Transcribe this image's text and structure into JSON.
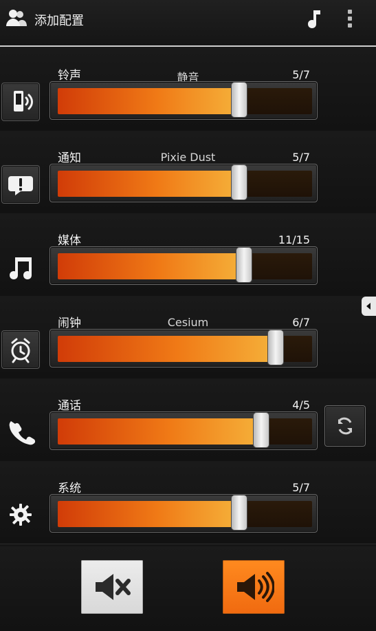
{
  "topbar": {
    "title": "添加配置",
    "icons": [
      "user-group-icon",
      "music-note-icon",
      "overflow-menu-icon"
    ]
  },
  "sliders": [
    {
      "label": "铃声",
      "tone": "静音",
      "value_text": "5/7",
      "value": 5,
      "max": 7,
      "icon": "ringer-phone-icon",
      "icon_has_button": true
    },
    {
      "label": "通知",
      "tone": "Pixie Dust",
      "value_text": "5/7",
      "value": 5,
      "max": 7,
      "icon": "notification-icon",
      "icon_has_button": true
    },
    {
      "label": "媒体",
      "tone": "",
      "value_text": "11/15",
      "value": 11,
      "max": 15,
      "icon": "music-note-icon",
      "icon_has_button": false
    },
    {
      "label": "闹钟",
      "tone": "Cesium",
      "value_text": "6/7",
      "value": 6,
      "max": 7,
      "icon": "alarm-icon",
      "icon_has_button": true
    },
    {
      "label": "通话",
      "tone": "",
      "value_text": "4/5",
      "value": 4,
      "max": 5,
      "icon": "phone-icon",
      "icon_has_button": false,
      "has_sync_button": true
    },
    {
      "label": "系统",
      "tone": "",
      "value_text": "5/7",
      "value": 5,
      "max": 7,
      "icon": "settings-gear-icon",
      "icon_has_button": false
    }
  ],
  "bottom_buttons": [
    {
      "name": "mute",
      "icon": "mute-icon",
      "active": false
    },
    {
      "name": "sound-on",
      "icon": "volume-icon",
      "active": true
    }
  ],
  "colors": {
    "accent_orange": "#f07a16",
    "accent_orange_dark": "#d13c08",
    "background": "#141414"
  }
}
